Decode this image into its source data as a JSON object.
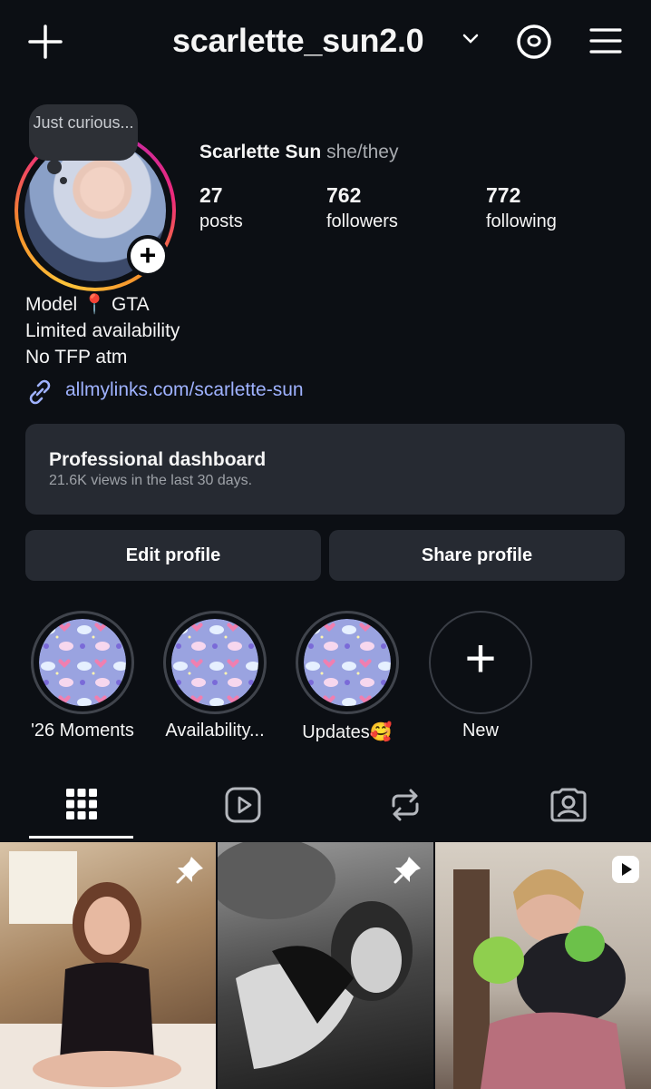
{
  "header": {
    "username": "scarlette_sun2.0"
  },
  "profile": {
    "note": "Just curious...",
    "name": "Scarlette Sun",
    "pronouns": "she/they",
    "stats": [
      {
        "value": "27",
        "label": "posts"
      },
      {
        "value": "762",
        "label": "followers"
      },
      {
        "value": "772",
        "label": "following"
      }
    ],
    "bio": [
      "Model 📍 GTA",
      "Limited availability",
      "No TFP atm"
    ],
    "link": "allmylinks.com/scarlette-sun"
  },
  "dashboard": {
    "title": "Professional dashboard",
    "subtitle": "21.6K views in the last 30 days."
  },
  "buttons": {
    "edit": "Edit profile",
    "share": "Share profile"
  },
  "highlights": [
    {
      "label": "'26 Moments"
    },
    {
      "label": "Availability..."
    },
    {
      "label": "Updates🥰"
    },
    {
      "label": "New"
    }
  ],
  "tabs": [
    "grid-icon",
    "reels-icon",
    "reposts-icon",
    "tagged-icon"
  ],
  "colors": {
    "background": "#0c0f14",
    "surface": "#262a32",
    "link": "#9fb2ff",
    "story_ring": [
      "#fdc43a",
      "#ee2a7b",
      "#c32aa3"
    ]
  }
}
